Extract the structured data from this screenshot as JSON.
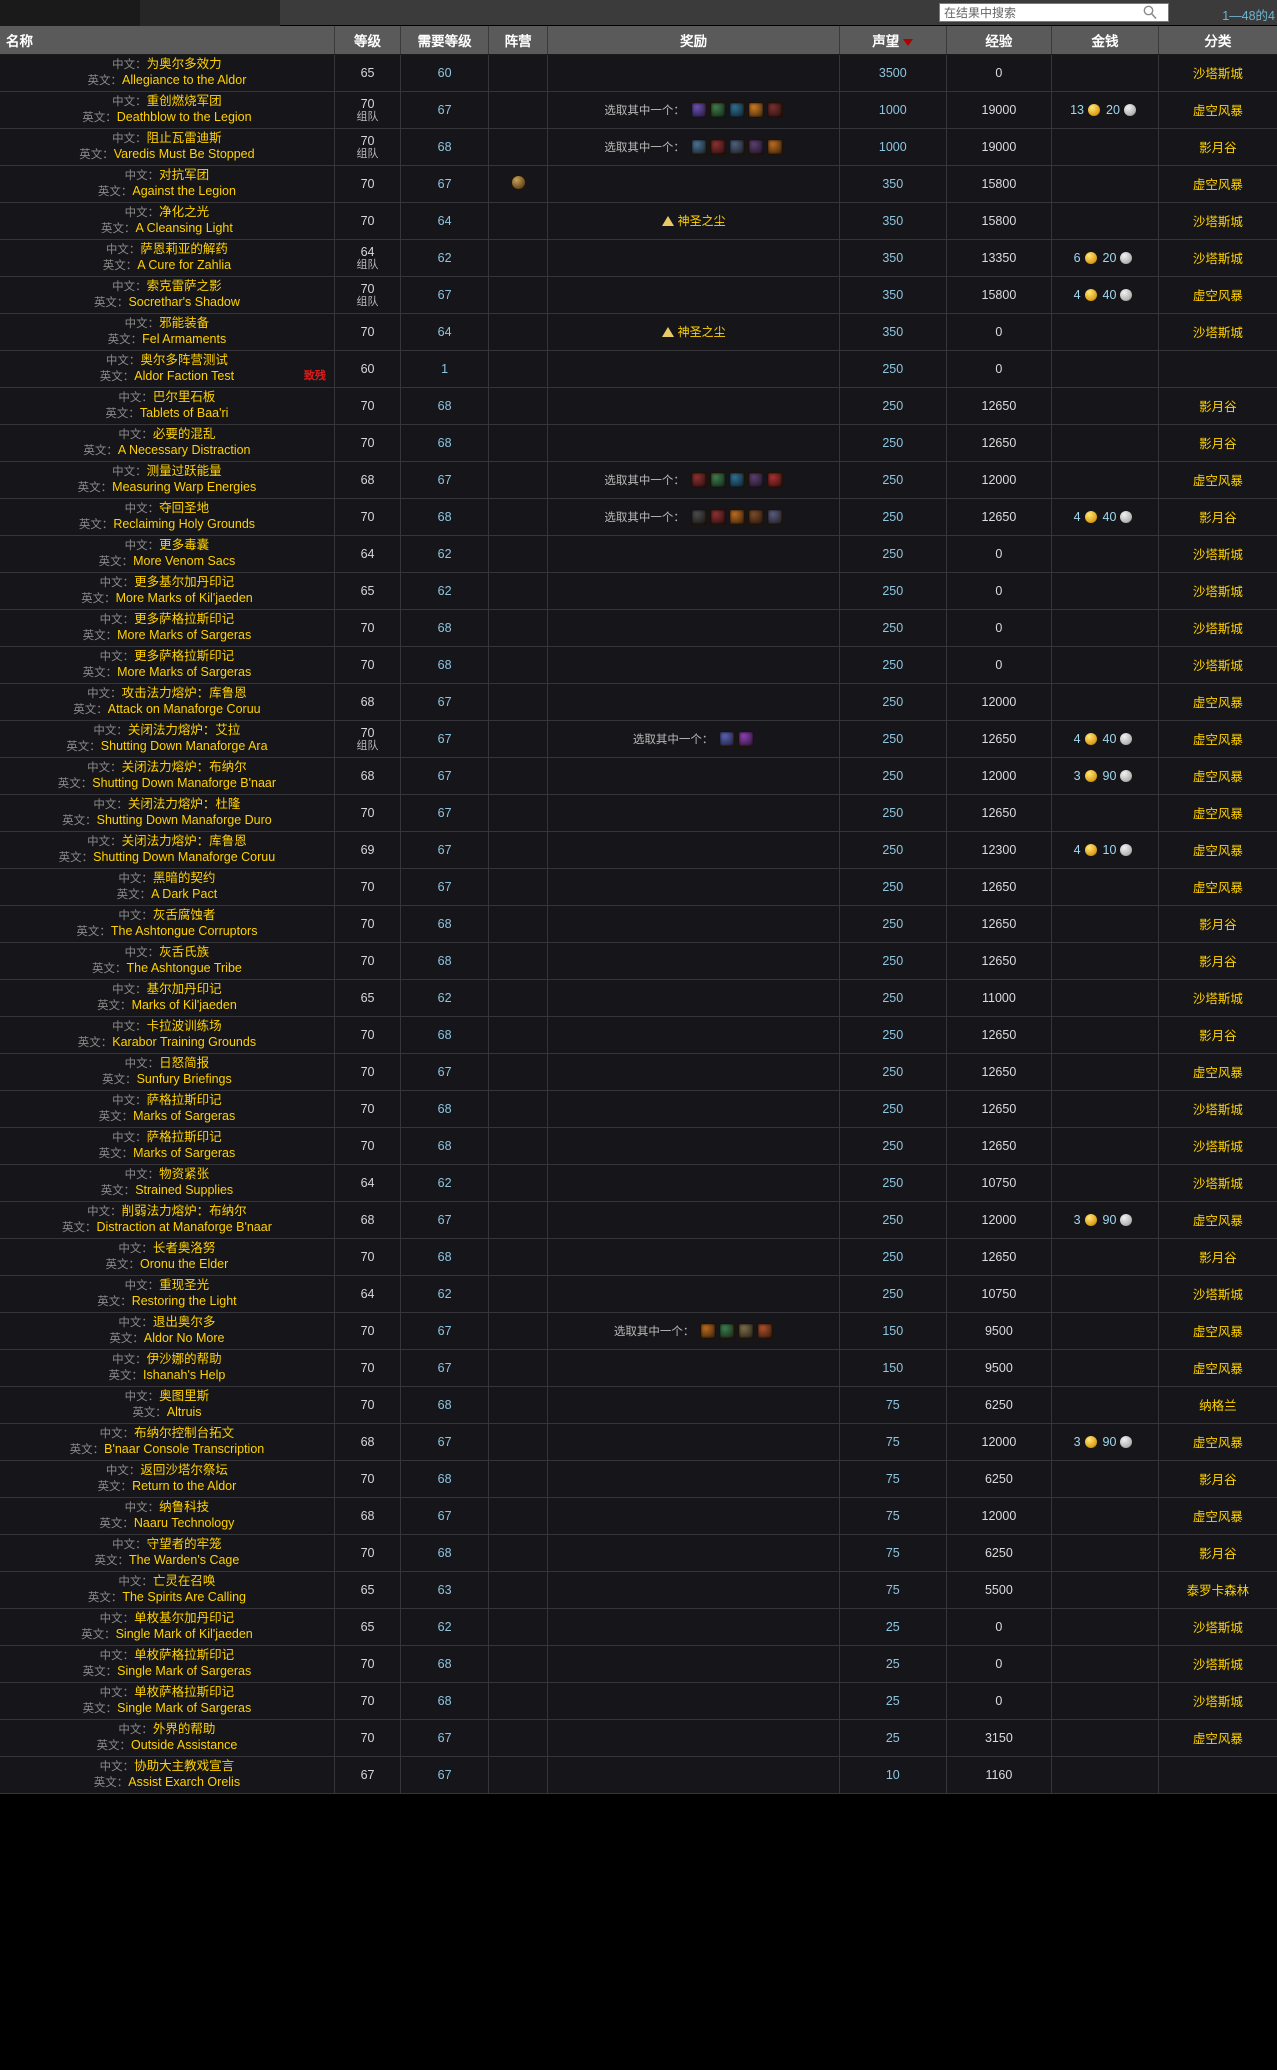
{
  "topbar": {
    "search_placeholder": "在结果中搜索",
    "search_value": "",
    "search_icon": "magnifier-icon",
    "result_count": "1—48的4"
  },
  "columns": {
    "name": "名称",
    "level": "等级",
    "req_level": "需要等级",
    "faction": "阵营",
    "rewards": "奖励",
    "reputation": "声望",
    "experience": "经验",
    "money": "金钱",
    "category": "分类"
  },
  "row_labels": {
    "cn": "中文：",
    "en": "英文："
  },
  "reward_texts": {
    "choose_one": "选取其中一个：",
    "holy_dust": "神圣之尘"
  },
  "rows": [
    {
      "cn": "为奥尔多效力",
      "en": "Allegiance to the Aldor",
      "level": "65",
      "level_sub": "",
      "req": "60",
      "faction": "",
      "rew_label": "",
      "rew_icons": [],
      "rew_text": "",
      "rep": "3500",
      "exp": "0",
      "gold": "",
      "silver": "",
      "cat": "沙塔斯城",
      "flag": ""
    },
    {
      "cn": "重创燃烧军团",
      "en": "Deathblow to the Legion",
      "level": "70",
      "level_sub": "组队",
      "req": "67",
      "faction": "",
      "rew_label": "选取其中一个：",
      "rew_icons": [
        "#6a4fae",
        "#3f7a4b",
        "#2f6d8e",
        "#c97a25",
        "#7a2f2f"
      ],
      "rew_text": "",
      "rep": "1000",
      "exp": "19000",
      "gold": "13",
      "silver": "20",
      "cat": "虚空风暴",
      "flag": ""
    },
    {
      "cn": "阻止瓦雷迪斯",
      "en": "Varedis Must Be Stopped",
      "level": "70",
      "level_sub": "组队",
      "req": "68",
      "faction": "",
      "rew_label": "选取其中一个：",
      "rew_icons": [
        "#4a6f8e",
        "#8a3030",
        "#4e5f7a",
        "#5a3f6d",
        "#b86a20"
      ],
      "rew_text": "",
      "rep": "1000",
      "exp": "19000",
      "gold": "",
      "silver": "",
      "cat": "影月谷",
      "flag": ""
    },
    {
      "cn": "对抗军团",
      "en": "Against the Legion",
      "level": "70",
      "level_sub": "",
      "req": "67",
      "faction": "faction-icon",
      "rew_label": "",
      "rew_icons": [],
      "rew_text": "",
      "rep": "350",
      "exp": "15800",
      "gold": "",
      "silver": "",
      "cat": "虚空风暴",
      "flag": ""
    },
    {
      "cn": "净化之光",
      "en": "A Cleansing Light",
      "level": "70",
      "level_sub": "",
      "req": "64",
      "faction": "",
      "rew_label": "",
      "rew_icons": [],
      "rew_text": "神圣之尘",
      "rep": "350",
      "exp": "15800",
      "gold": "",
      "silver": "",
      "cat": "沙塔斯城",
      "flag": ""
    },
    {
      "cn": "萨恩莉亚的解药",
      "en": "A Cure for Zahlia",
      "level": "64",
      "level_sub": "组队",
      "req": "62",
      "faction": "",
      "rew_label": "",
      "rew_icons": [],
      "rew_text": "",
      "rep": "350",
      "exp": "13350",
      "gold": "6",
      "silver": "20",
      "cat": "沙塔斯城",
      "flag": ""
    },
    {
      "cn": "索克雷萨之影",
      "en": "Socrethar's Shadow",
      "level": "70",
      "level_sub": "组队",
      "req": "67",
      "faction": "",
      "rew_label": "",
      "rew_icons": [],
      "rew_text": "",
      "rep": "350",
      "exp": "15800",
      "gold": "4",
      "silver": "40",
      "cat": "虚空风暴",
      "flag": ""
    },
    {
      "cn": "邪能装备",
      "en": "Fel Armaments",
      "level": "70",
      "level_sub": "",
      "req": "64",
      "faction": "",
      "rew_label": "",
      "rew_icons": [],
      "rew_text": "神圣之尘",
      "rep": "350",
      "exp": "0",
      "gold": "",
      "silver": "",
      "cat": "沙塔斯城",
      "flag": ""
    },
    {
      "cn": "奥尔多阵营测试",
      "en": "Aldor Faction Test",
      "level": "60",
      "level_sub": "",
      "req": "1",
      "faction": "",
      "rew_label": "",
      "rew_icons": [],
      "rew_text": "",
      "rep": "250",
      "exp": "0",
      "gold": "",
      "silver": "",
      "cat": "",
      "flag": "致残"
    },
    {
      "cn": "巴尔里石板",
      "en": "Tablets of Baa'ri",
      "level": "70",
      "level_sub": "",
      "req": "68",
      "faction": "",
      "rew_label": "",
      "rew_icons": [],
      "rew_text": "",
      "rep": "250",
      "exp": "12650",
      "gold": "",
      "silver": "",
      "cat": "影月谷",
      "flag": ""
    },
    {
      "cn": "必要的混乱",
      "en": "A Necessary Distraction",
      "level": "70",
      "level_sub": "",
      "req": "68",
      "faction": "",
      "rew_label": "",
      "rew_icons": [],
      "rew_text": "",
      "rep": "250",
      "exp": "12650",
      "gold": "",
      "silver": "",
      "cat": "影月谷",
      "flag": ""
    },
    {
      "cn": "测量过跃能量",
      "en": "Measuring Warp Energies",
      "level": "68",
      "level_sub": "",
      "req": "67",
      "faction": "",
      "rew_label": "选取其中一个：",
      "rew_icons": [
        "#8a3030",
        "#3f7a4b",
        "#2f6d8e",
        "#5a3f6d",
        "#a83030"
      ],
      "rew_text": "",
      "rep": "250",
      "exp": "12000",
      "gold": "",
      "silver": "",
      "cat": "虚空风暴",
      "flag": ""
    },
    {
      "cn": "夺回圣地",
      "en": "Reclaiming Holy Grounds",
      "level": "70",
      "level_sub": "",
      "req": "68",
      "faction": "",
      "rew_label": "选取其中一个：",
      "rew_icons": [
        "#4a4a4a",
        "#8a3030",
        "#b86a20",
        "#7a4a2a",
        "#5a5a7a"
      ],
      "rew_text": "",
      "rep": "250",
      "exp": "12650",
      "gold": "4",
      "silver": "40",
      "cat": "影月谷",
      "flag": ""
    },
    {
      "cn": "更多毒囊",
      "en": "More Venom Sacs",
      "level": "64",
      "level_sub": "",
      "req": "62",
      "faction": "",
      "rew_label": "",
      "rew_icons": [],
      "rew_text": "",
      "rep": "250",
      "exp": "0",
      "gold": "",
      "silver": "",
      "cat": "沙塔斯城",
      "flag": ""
    },
    {
      "cn": "更多基尔加丹印记",
      "en": "More Marks of Kil'jaeden",
      "level": "65",
      "level_sub": "",
      "req": "62",
      "faction": "",
      "rew_label": "",
      "rew_icons": [],
      "rew_text": "",
      "rep": "250",
      "exp": "0",
      "gold": "",
      "silver": "",
      "cat": "沙塔斯城",
      "flag": ""
    },
    {
      "cn": "更多萨格拉斯印记",
      "en": "More Marks of Sargeras",
      "level": "70",
      "level_sub": "",
      "req": "68",
      "faction": "",
      "rew_label": "",
      "rew_icons": [],
      "rew_text": "",
      "rep": "250",
      "exp": "0",
      "gold": "",
      "silver": "",
      "cat": "沙塔斯城",
      "flag": ""
    },
    {
      "cn": "更多萨格拉斯印记",
      "en": "More Marks of Sargeras",
      "level": "70",
      "level_sub": "",
      "req": "68",
      "faction": "",
      "rew_label": "",
      "rew_icons": [],
      "rew_text": "",
      "rep": "250",
      "exp": "0",
      "gold": "",
      "silver": "",
      "cat": "沙塔斯城",
      "flag": ""
    },
    {
      "cn": "攻击法力熔炉：库鲁恩",
      "en": "Attack on Manaforge Coruu",
      "level": "68",
      "level_sub": "",
      "req": "67",
      "faction": "",
      "rew_label": "",
      "rew_icons": [],
      "rew_text": "",
      "rep": "250",
      "exp": "12000",
      "gold": "",
      "silver": "",
      "cat": "虚空风暴",
      "flag": ""
    },
    {
      "cn": "关闭法力熔炉：艾拉",
      "en": "Shutting Down Manaforge Ara",
      "level": "70",
      "level_sub": "组队",
      "req": "67",
      "faction": "",
      "rew_label": "选取其中一个：",
      "rew_icons": [
        "#5a5fae",
        "#8a3fae"
      ],
      "rew_text": "",
      "rep": "250",
      "exp": "12650",
      "gold": "4",
      "silver": "40",
      "cat": "虚空风暴",
      "flag": ""
    },
    {
      "cn": "关闭法力熔炉：布纳尔",
      "en": "Shutting Down Manaforge B'naar",
      "level": "68",
      "level_sub": "",
      "req": "67",
      "faction": "",
      "rew_label": "",
      "rew_icons": [],
      "rew_text": "",
      "rep": "250",
      "exp": "12000",
      "gold": "3",
      "silver": "90",
      "cat": "虚空风暴",
      "flag": ""
    },
    {
      "cn": "关闭法力熔炉：杜隆",
      "en": "Shutting Down Manaforge Duro",
      "level": "70",
      "level_sub": "",
      "req": "67",
      "faction": "",
      "rew_label": "",
      "rew_icons": [],
      "rew_text": "",
      "rep": "250",
      "exp": "12650",
      "gold": "",
      "silver": "",
      "cat": "虚空风暴",
      "flag": ""
    },
    {
      "cn": "关闭法力熔炉：库鲁恩",
      "en": "Shutting Down Manaforge Coruu",
      "level": "69",
      "level_sub": "",
      "req": "67",
      "faction": "",
      "rew_label": "",
      "rew_icons": [],
      "rew_text": "",
      "rep": "250",
      "exp": "12300",
      "gold": "4",
      "silver": "10",
      "cat": "虚空风暴",
      "flag": ""
    },
    {
      "cn": "黑暗的契约",
      "en": "A Dark Pact",
      "level": "70",
      "level_sub": "",
      "req": "67",
      "faction": "",
      "rew_label": "",
      "rew_icons": [],
      "rew_text": "",
      "rep": "250",
      "exp": "12650",
      "gold": "",
      "silver": "",
      "cat": "虚空风暴",
      "flag": ""
    },
    {
      "cn": "灰舌腐蚀者",
      "en": "The Ashtongue Corruptors",
      "level": "70",
      "level_sub": "",
      "req": "68",
      "faction": "",
      "rew_label": "",
      "rew_icons": [],
      "rew_text": "",
      "rep": "250",
      "exp": "12650",
      "gold": "",
      "silver": "",
      "cat": "影月谷",
      "flag": ""
    },
    {
      "cn": "灰舌氏族",
      "en": "The Ashtongue Tribe",
      "level": "70",
      "level_sub": "",
      "req": "68",
      "faction": "",
      "rew_label": "",
      "rew_icons": [],
      "rew_text": "",
      "rep": "250",
      "exp": "12650",
      "gold": "",
      "silver": "",
      "cat": "影月谷",
      "flag": ""
    },
    {
      "cn": "基尔加丹印记",
      "en": "Marks of Kil'jaeden",
      "level": "65",
      "level_sub": "",
      "req": "62",
      "faction": "",
      "rew_label": "",
      "rew_icons": [],
      "rew_text": "",
      "rep": "250",
      "exp": "11000",
      "gold": "",
      "silver": "",
      "cat": "沙塔斯城",
      "flag": ""
    },
    {
      "cn": "卡拉波训练场",
      "en": "Karabor Training Grounds",
      "level": "70",
      "level_sub": "",
      "req": "68",
      "faction": "",
      "rew_label": "",
      "rew_icons": [],
      "rew_text": "",
      "rep": "250",
      "exp": "12650",
      "gold": "",
      "silver": "",
      "cat": "影月谷",
      "flag": ""
    },
    {
      "cn": "日怒简报",
      "en": "Sunfury Briefings",
      "level": "70",
      "level_sub": "",
      "req": "67",
      "faction": "",
      "rew_label": "",
      "rew_icons": [],
      "rew_text": "",
      "rep": "250",
      "exp": "12650",
      "gold": "",
      "silver": "",
      "cat": "虚空风暴",
      "flag": ""
    },
    {
      "cn": "萨格拉斯印记",
      "en": "Marks of Sargeras",
      "level": "70",
      "level_sub": "",
      "req": "68",
      "faction": "",
      "rew_label": "",
      "rew_icons": [],
      "rew_text": "",
      "rep": "250",
      "exp": "12650",
      "gold": "",
      "silver": "",
      "cat": "沙塔斯城",
      "flag": ""
    },
    {
      "cn": "萨格拉斯印记",
      "en": "Marks of Sargeras",
      "level": "70",
      "level_sub": "",
      "req": "68",
      "faction": "",
      "rew_label": "",
      "rew_icons": [],
      "rew_text": "",
      "rep": "250",
      "exp": "12650",
      "gold": "",
      "silver": "",
      "cat": "沙塔斯城",
      "flag": ""
    },
    {
      "cn": "物资紧张",
      "en": "Strained Supplies",
      "level": "64",
      "level_sub": "",
      "req": "62",
      "faction": "",
      "rew_label": "",
      "rew_icons": [],
      "rew_text": "",
      "rep": "250",
      "exp": "10750",
      "gold": "",
      "silver": "",
      "cat": "沙塔斯城",
      "flag": ""
    },
    {
      "cn": "削弱法力熔炉：布纳尔",
      "en": "Distraction at Manaforge B'naar",
      "level": "68",
      "level_sub": "",
      "req": "67",
      "faction": "",
      "rew_label": "",
      "rew_icons": [],
      "rew_text": "",
      "rep": "250",
      "exp": "12000",
      "gold": "3",
      "silver": "90",
      "cat": "虚空风暴",
      "flag": ""
    },
    {
      "cn": "长者奥洛努",
      "en": "Oronu the Elder",
      "level": "70",
      "level_sub": "",
      "req": "68",
      "faction": "",
      "rew_label": "",
      "rew_icons": [],
      "rew_text": "",
      "rep": "250",
      "exp": "12650",
      "gold": "",
      "silver": "",
      "cat": "影月谷",
      "flag": ""
    },
    {
      "cn": "重现圣光",
      "en": "Restoring the Light",
      "level": "64",
      "level_sub": "",
      "req": "62",
      "faction": "",
      "rew_label": "",
      "rew_icons": [],
      "rew_text": "",
      "rep": "250",
      "exp": "10750",
      "gold": "",
      "silver": "",
      "cat": "沙塔斯城",
      "flag": ""
    },
    {
      "cn": "退出奥尔多",
      "en": "Aldor No More",
      "level": "70",
      "level_sub": "",
      "req": "67",
      "faction": "",
      "rew_label": "选取其中一个：",
      "rew_icons": [
        "#b86a20",
        "#3f7a4b",
        "#7a6a4a",
        "#a8502a"
      ],
      "rew_text": "",
      "rep": "150",
      "exp": "9500",
      "gold": "",
      "silver": "",
      "cat": "虚空风暴",
      "flag": ""
    },
    {
      "cn": "伊沙娜的帮助",
      "en": "Ishanah's Help",
      "level": "70",
      "level_sub": "",
      "req": "67",
      "faction": "",
      "rew_label": "",
      "rew_icons": [],
      "rew_text": "",
      "rep": "150",
      "exp": "9500",
      "gold": "",
      "silver": "",
      "cat": "虚空风暴",
      "flag": ""
    },
    {
      "cn": "奥图里斯",
      "en": "Altruis",
      "level": "70",
      "level_sub": "",
      "req": "68",
      "faction": "",
      "rew_label": "",
      "rew_icons": [],
      "rew_text": "",
      "rep": "75",
      "exp": "6250",
      "gold": "",
      "silver": "",
      "cat": "纳格兰",
      "flag": ""
    },
    {
      "cn": "布纳尔控制台拓文",
      "en": "B'naar Console Transcription",
      "level": "68",
      "level_sub": "",
      "req": "67",
      "faction": "",
      "rew_label": "",
      "rew_icons": [],
      "rew_text": "",
      "rep": "75",
      "exp": "12000",
      "gold": "3",
      "silver": "90",
      "cat": "虚空风暴",
      "flag": ""
    },
    {
      "cn": "返回沙塔尔祭坛",
      "en": "Return to the Aldor",
      "level": "70",
      "level_sub": "",
      "req": "68",
      "faction": "",
      "rew_label": "",
      "rew_icons": [],
      "rew_text": "",
      "rep": "75",
      "exp": "6250",
      "gold": "",
      "silver": "",
      "cat": "影月谷",
      "flag": ""
    },
    {
      "cn": "纳鲁科技",
      "en": "Naaru Technology",
      "level": "68",
      "level_sub": "",
      "req": "67",
      "faction": "",
      "rew_label": "",
      "rew_icons": [],
      "rew_text": "",
      "rep": "75",
      "exp": "12000",
      "gold": "",
      "silver": "",
      "cat": "虚空风暴",
      "flag": ""
    },
    {
      "cn": "守望者的牢笼",
      "en": "The Warden's Cage",
      "level": "70",
      "level_sub": "",
      "req": "68",
      "faction": "",
      "rew_label": "",
      "rew_icons": [],
      "rew_text": "",
      "rep": "75",
      "exp": "6250",
      "gold": "",
      "silver": "",
      "cat": "影月谷",
      "flag": ""
    },
    {
      "cn": "亡灵在召唤",
      "en": "The Spirits Are Calling",
      "level": "65",
      "level_sub": "",
      "req": "63",
      "faction": "",
      "rew_label": "",
      "rew_icons": [],
      "rew_text": "",
      "rep": "75",
      "exp": "5500",
      "gold": "",
      "silver": "",
      "cat": "泰罗卡森林",
      "flag": ""
    },
    {
      "cn": "单枚基尔加丹印记",
      "en": "Single Mark of Kil'jaeden",
      "level": "65",
      "level_sub": "",
      "req": "62",
      "faction": "",
      "rew_label": "",
      "rew_icons": [],
      "rew_text": "",
      "rep": "25",
      "exp": "0",
      "gold": "",
      "silver": "",
      "cat": "沙塔斯城",
      "flag": ""
    },
    {
      "cn": "单枚萨格拉斯印记",
      "en": "Single Mark of Sargeras",
      "level": "70",
      "level_sub": "",
      "req": "68",
      "faction": "",
      "rew_label": "",
      "rew_icons": [],
      "rew_text": "",
      "rep": "25",
      "exp": "0",
      "gold": "",
      "silver": "",
      "cat": "沙塔斯城",
      "flag": ""
    },
    {
      "cn": "单枚萨格拉斯印记",
      "en": "Single Mark of Sargeras",
      "level": "70",
      "level_sub": "",
      "req": "68",
      "faction": "",
      "rew_label": "",
      "rew_icons": [],
      "rew_text": "",
      "rep": "25",
      "exp": "0",
      "gold": "",
      "silver": "",
      "cat": "沙塔斯城",
      "flag": ""
    },
    {
      "cn": "外界的帮助",
      "en": "Outside Assistance",
      "level": "70",
      "level_sub": "",
      "req": "67",
      "faction": "",
      "rew_label": "",
      "rew_icons": [],
      "rew_text": "",
      "rep": "25",
      "exp": "3150",
      "gold": "",
      "silver": "",
      "cat": "虚空风暴",
      "flag": ""
    },
    {
      "cn": "协助大主教戏宣言",
      "en": "Assist Exarch Orelis",
      "level": "67",
      "level_sub": "",
      "req": "67",
      "faction": "",
      "rew_label": "",
      "rew_icons": [],
      "rew_text": "",
      "rep": "10",
      "exp": "1160",
      "gold": "",
      "silver": "",
      "cat": "",
      "flag": ""
    }
  ]
}
